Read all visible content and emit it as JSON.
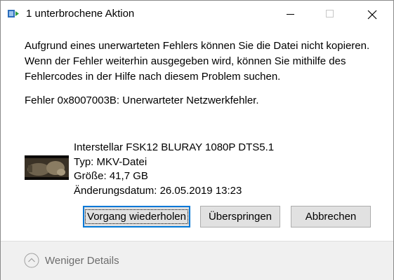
{
  "window": {
    "title": "1 unterbrochene Aktion"
  },
  "message": {
    "lines": [
      "Aufgrund eines unerwarteten Fehlers können Sie die Datei nicht kopieren.",
      "Wenn der Fehler weiterhin ausgegeben wird, können Sie mithilfe des",
      "Fehlercodes in der Hilfe nach diesem Problem suchen."
    ],
    "error": "Fehler 0x8007003B: Unerwarteter Netzwerkfehler."
  },
  "file": {
    "name": "Interstellar FSK12 BLURAY 1080P DTS5.1",
    "type": "Typ: MKV-Datei",
    "size": "Größe: 41,7 GB",
    "modified": "Änderungsdatum: 26.05.2019 13:23"
  },
  "buttons": {
    "retry": "Vorgang wiederholen",
    "skip": "Überspringen",
    "cancel": "Abbrechen"
  },
  "footer": {
    "less_details": "Weniger Details"
  },
  "icons": {
    "app": "file-copy-icon",
    "minimize": "minimize-icon",
    "maximize": "maximize-icon",
    "close": "close-icon",
    "collapse": "chevron-up-circle-icon"
  },
  "colors": {
    "accent": "#0078d7",
    "footer_bg": "#f0f0f0",
    "button_bg": "#e1e1e1"
  }
}
